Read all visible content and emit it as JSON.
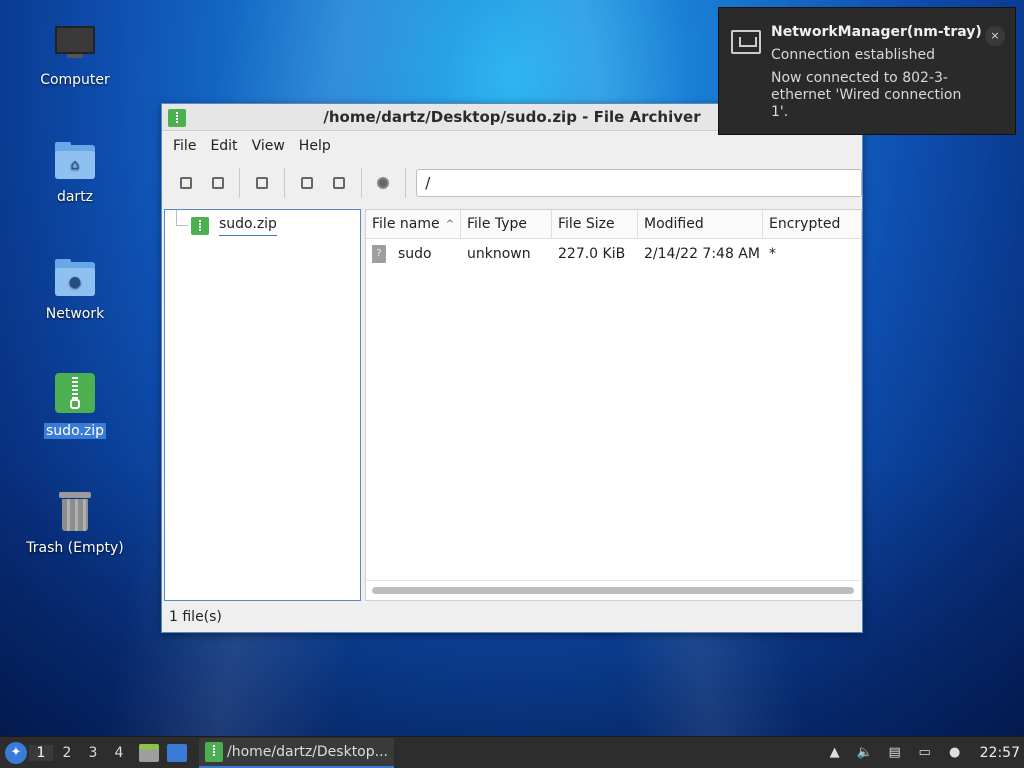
{
  "desktop": {
    "icons": [
      {
        "label": "Computer",
        "icon": "computer-icon"
      },
      {
        "label": "dartz",
        "icon": "home-folder-icon"
      },
      {
        "label": "Network",
        "icon": "network-folder-icon"
      },
      {
        "label": "sudo.zip",
        "icon": "zip-archive-icon",
        "selected": true
      },
      {
        "label": "Trash (Empty)",
        "icon": "trash-icon"
      }
    ]
  },
  "window": {
    "title": "/home/dartz/Desktop/sudo.zip - File Archiver",
    "menus": [
      "File",
      "Edit",
      "View",
      "Help"
    ],
    "toolbar": {
      "buttons": [
        "new-archive-icon",
        "open-archive-icon",
        "extract-icon",
        "add-file-icon",
        "add-folder-icon",
        "stop-icon"
      ],
      "path": "/"
    },
    "tree": {
      "root": "sudo.zip"
    },
    "list": {
      "columns": [
        "File name",
        "File Type",
        "File Size",
        "Modified",
        "Encrypted"
      ],
      "sort_indicator": "^",
      "rows": [
        {
          "name": "sudo",
          "type": "unknown",
          "size": "227.0 KiB",
          "modified": "2/14/22 7:48 AM",
          "encrypted": "*",
          "icon_glyph": "?"
        }
      ]
    },
    "status": "1 file(s)"
  },
  "notification": {
    "title": "NetworkManager(nm-tray)",
    "subtitle": "Connection established",
    "body": "Now connected to 802-3-ethernet 'Wired connection 1'.",
    "close": "×"
  },
  "taskbar": {
    "desktops": [
      "1",
      "2",
      "3",
      "4"
    ],
    "active_desktop": "1",
    "task_label": "/home/dartz/Desktop...",
    "clock": "22:57"
  },
  "colors": {
    "accent": "#3a7bd5",
    "zip_green": "#4caf50",
    "panel": "#2d2d2d"
  }
}
